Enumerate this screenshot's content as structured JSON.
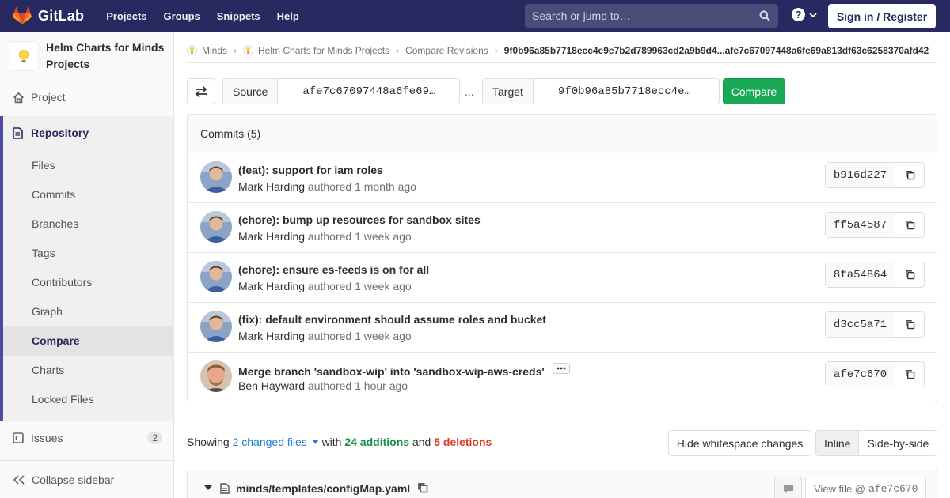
{
  "navbar": {
    "brand": "GitLab",
    "links": [
      "Projects",
      "Groups",
      "Snippets",
      "Help"
    ],
    "search_placeholder": "Search or jump to…",
    "help_icon": "question-circle-icon",
    "signin_label": "Sign in / Register",
    "colors": {
      "background": "#292961",
      "accent": "#fc6d26"
    }
  },
  "sidebar": {
    "project_name": "Helm Charts for Minds Projects",
    "project_item": "Project",
    "repository_label": "Repository",
    "repository_items": [
      "Files",
      "Commits",
      "Branches",
      "Tags",
      "Contributors",
      "Graph",
      "Compare",
      "Charts",
      "Locked Files"
    ],
    "active_item": "Compare",
    "issues_label": "Issues",
    "issues_count": "2",
    "collapse_label": "Collapse sidebar"
  },
  "breadcrumb": {
    "items": [
      "Minds",
      "Helm Charts for Minds Projects",
      "Compare Revisions"
    ],
    "current": "9f0b96a85b7718ecc4e9e7b2d789963cd2a9b9d4...afe7c67097448a6fe69a813df63c6258370afd42"
  },
  "compare": {
    "source_label": "Source",
    "source_value": "afe7c67097448a6fe69…",
    "separator": "...",
    "target_label": "Target",
    "target_value": "9f0b96a85b7718ecc4e…",
    "compare_button": "Compare"
  },
  "commits": {
    "header": "Commits (5)",
    "authored_word": "authored",
    "rows": [
      {
        "title": "(feat): support for iam roles",
        "author": "Mark Harding",
        "time": "1 month ago",
        "sha": "b916d227",
        "has_ellipsis": false
      },
      {
        "title": "(chore): bump up resources for sandbox sites",
        "author": "Mark Harding",
        "time": "1 week ago",
        "sha": "ff5a4587",
        "has_ellipsis": false
      },
      {
        "title": "(chore): ensure es-feeds is on for all",
        "author": "Mark Harding",
        "time": "1 week ago",
        "sha": "8fa54864",
        "has_ellipsis": false
      },
      {
        "title": "(fix): default environment should assume roles and bucket",
        "author": "Mark Harding",
        "time": "1 week ago",
        "sha": "d3cc5a71",
        "has_ellipsis": false
      },
      {
        "title": "Merge branch 'sandbox-wip' into 'sandbox-wip-aws-creds'",
        "author": "Ben Hayward",
        "time": "1 hour ago",
        "sha": "afe7c670",
        "has_ellipsis": true
      }
    ]
  },
  "diff_stats": {
    "showing": "Showing",
    "changed_files": "2 changed files",
    "with": "with",
    "additions": "24 additions",
    "and": "and",
    "deletions": "5 deletions"
  },
  "diff_controls": {
    "whitespace_button": "Hide whitespace changes",
    "inline": "Inline",
    "side_by_side": "Side-by-side"
  },
  "file": {
    "name": "minds/templates/configMap.yaml",
    "view_file_label": "View file @",
    "view_file_sha": "afe7c670"
  }
}
